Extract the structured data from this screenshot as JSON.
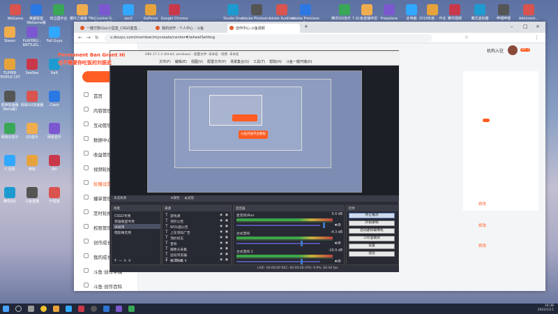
{
  "desktop": {
    "icons_top": [
      "WeGame",
      "英雄联盟 WeGame版",
      "鸣泣国平台",
      "哪吒之魔童 TRL",
      "Counter-S... Global Off...",
      "zev2",
      "GeForce Experience",
      "Google Chrome",
      "Studio One",
      "Adobe Photosh...",
      "Adobe Audition ...",
      "Adobe Premiere P...",
      "腾讯QQ音乐 7.2",
      "斗鱼直播伴侣",
      "Freeplane",
      "此电脑",
      "2019年度... 作业",
      "腾讯视频",
      "鹰式虚拟器",
      "哔哩哔哩",
      "Administr..."
    ],
    "icons_left": [
      "Steam",
      "PLAYERU... BATTLEG...",
      "Fall Guys",
      "TLPPER PEOPLE CET",
      "SeeSee",
      "Raft",
      "雷神加速器 (Beta版)",
      "网易UU加速器",
      "Clash",
      "网易云音乐",
      "QQ音乐",
      "网易音乐",
      "C 迅雷",
      "咪咕",
      "Bili",
      "腾讯QQ",
      "斗鱼直播",
      "YY语音"
    ]
  },
  "browser": {
    "tabs": [
      "一键付款(Go)小型盒_CSGO盒直...",
      "我的创作 - 个人中心 - 斗鱼",
      "创作中心-斗鱼视频"
    ],
    "active_tab": 2,
    "url": "v.douyu.com/member/mycreate/center#/wheelSetting",
    "user_link": "机构入驻",
    "user_tag": "UP 3",
    "sidebar": [
      {
        "label": "首页",
        "active": false
      },
      {
        "label": "内容管理",
        "active": false
      },
      {
        "label": "互动管理",
        "active": false
      },
      {
        "label": "数据中心",
        "active": false
      },
      {
        "label": "收益管理",
        "active": false
      },
      {
        "label": "视频轮播",
        "active": false
      },
      {
        "label": "轮播设置",
        "active": true
      },
      {
        "label": "播单管理",
        "active": false
      },
      {
        "label": "定时轮播",
        "active": false
      },
      {
        "label": "权限管理",
        "active": false
      },
      {
        "label": "创作成长",
        "active": false
      },
      {
        "label": "我的成长",
        "active": false
      },
      {
        "label": "斗鱼·创作学院",
        "active": false
      },
      {
        "label": "斗鱼·创作百科",
        "active": false
      }
    ],
    "modify_links": [
      "修改",
      "修改",
      "修改"
    ]
  },
  "obs": {
    "title": "OBS 27.1.3 (64-bit, windows) - 配置文件: 未命名 - 场景: 未命名",
    "menu": [
      "文件(F)",
      "编辑(E)",
      "视图(V)",
      "配置文件(P)",
      "场景集合(S)",
      "工具(T)",
      "帮助(H)",
      "斗鱼一键开播(D)"
    ],
    "overlay_line1": "Permanent Ban Grant Hi",
    "overlay_line2": "也不需要你吃饭的刘振武",
    "dock_header_label": "未选择源",
    "dock_header_props": "属性",
    "dock_header_filters": "滤镜",
    "panel_scenes": "场景",
    "panel_sources": "来源",
    "panel_mixer": "混音器",
    "panel_transitions": "转场",
    "panel_controls": "控件",
    "scenes": [
      {
        "name": "CSGO专用",
        "selected": false
      },
      {
        "name": "英雄联盟专用",
        "selected": false
      },
      {
        "name": "录屏用",
        "selected": true
      },
      {
        "name": "暗影精灵用",
        "selected": false
      }
    ],
    "sources": [
      {
        "name": "游戏源",
        "selected": false
      },
      {
        "name": "顶开公告",
        "selected": false
      },
      {
        "name": "WOL图公告",
        "selected": false
      },
      {
        "name": "上车须知广告",
        "selected": false
      },
      {
        "name": "顶栏标志",
        "selected": false
      },
      {
        "name": "音效",
        "selected": false
      },
      {
        "name": "摄像头采集",
        "selected": false
      },
      {
        "name": "运动浏览器",
        "selected": false
      },
      {
        "name": "窗口采集",
        "selected": false
      }
    ],
    "mixer": [
      {
        "name": "麦克风/Aux",
        "db": "0.0 dB"
      },
      {
        "name": "台式音响",
        "db": "-4.3 dB"
      },
      {
        "name": "台式音响 2",
        "db": "-19.9 dB"
      }
    ],
    "controls": [
      {
        "label": "停止推流",
        "on": true
      },
      {
        "label": "开始录制",
        "on": false
      },
      {
        "label": "启动虚拟摄像机",
        "on": false
      },
      {
        "label": "工作室模式",
        "on": false
      },
      {
        "label": "设置",
        "on": false
      },
      {
        "label": "退出",
        "on": false
      }
    ],
    "status": "LIVE: 00:00:00   REC: 00:00:00   CPU: 9.9%, 60.00 fps",
    "preview_banner": "斗鱼开放平台教程"
  },
  "taskbar": {
    "time": "16:38",
    "date": "2022/1/11"
  }
}
